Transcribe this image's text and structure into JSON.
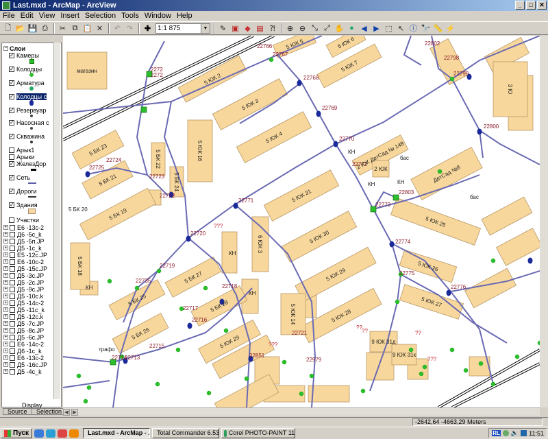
{
  "window": {
    "title": "Last.mxd - ArcMap - ArcView",
    "minimize": "_",
    "maximize": "□",
    "close": "✕"
  },
  "menu": [
    "File",
    "Edit",
    "View",
    "Insert",
    "Selection",
    "Tools",
    "Window",
    "Help"
  ],
  "toolbar": {
    "scale_value": "1:1 875"
  },
  "toc": {
    "root": "Слои",
    "layers": [
      {
        "label": "Камеры",
        "checked": true
      },
      {
        "label": "Колодцы",
        "checked": true
      },
      {
        "label": "Арматура",
        "checked": true
      },
      {
        "label": "Колодцы с",
        "checked": true,
        "selected": true
      },
      {
        "label": "Резервуар",
        "checked": true
      },
      {
        "label": "Насосная с",
        "checked": true
      },
      {
        "label": "Скважина",
        "checked": true
      },
      {
        "label": "Арык1",
        "checked": false
      },
      {
        "label": "Арыки",
        "checked": false
      },
      {
        "label": "ЖелезДор",
        "checked": true
      },
      {
        "label": "Сеть",
        "checked": true
      },
      {
        "label": "Дороги",
        "checked": true
      },
      {
        "label": "Здания",
        "checked": true
      },
      {
        "label": "Участки",
        "checked": false
      }
    ],
    "rasters": [
      "Е6 -13с-2",
      "Д6 -5с_k",
      "Д5 -5п.JP",
      "Д5 -1с_k",
      "Е5 -12с.JP",
      "Е6 -10с-2",
      "Д5 -15с.JP",
      "Д5 -3с.JP",
      "Д5 -2с.JP",
      "Д5 -9с.JP",
      "Д5 -10с.k",
      "Д5 -14с-2",
      "Д5 -11с_k",
      "Д5 -12с.k",
      "Д5 -7с.JP",
      "Д5 -8с.JP",
      "Д5 -6с.JP",
      "Е6 -14с-2",
      "Д6 -1с_k",
      "Е6 -13с-2",
      "Д5 -16с.JP",
      "Д5 -4с_k"
    ],
    "display_label": "Display",
    "tab_source": "Source",
    "tab_selection": "Selection"
  },
  "map": {
    "labels": {
      "l22766": "22766",
      "l22767": "22767",
      "l22768": "22768",
      "l22769": "22769",
      "l22770": "22770",
      "l22772": "22772",
      "l22771": "22771",
      "l22773": "22773",
      "l22774": "22774",
      "l22775": "22775",
      "l22776": "22776",
      "l22798": "22798",
      "l22799": "22799",
      "l22800": "22800",
      "l22802": "22802",
      "l22803": "22803",
      "l22724": "22724",
      "l22725": "22725",
      "l22723": "22723",
      "l22722": "22722",
      "l22720": "22720",
      "l22719": "22719",
      "l22735": "22735",
      "l22718": "22718",
      "l22717": "22717",
      "l22716": "22716",
      "l22715": "22715",
      "l22714": "22714",
      "l22713": "22713",
      "l22721": "22721",
      "l22851": "22851",
      "l22979": "22979",
      "l2272a": "2272",
      "l2272b": "2272",
      "q1": "???",
      "q2": "???",
      "q3": "???",
      "q4": "??",
      "q5": "??",
      "q6": "??"
    },
    "buildings": {
      "magazin": "магазин",
      "b5uk5": "5 ЮК  5",
      "b5uk6": "5 ЮК  6",
      "b5uk7": "5 ЮК  7",
      "b5uk2": "5 ЮК  2",
      "b5uk3": "5 ЮК  3",
      "b5uk4": "5 ЮК  4",
      "b5uk16": "5 ЮК  16",
      "b5bk23": "5 БК  23",
      "b5bk22": "5 БК  22",
      "b5bk24": "5 БК  24",
      "b5bk21": "5 БК  21",
      "b5bk20": "5 БК  20",
      "b5bk19": "5 БК  19",
      "b5bk18": "5 БК  18",
      "b5bk27": "5 БК  27",
      "b5bk25": "5 БК  25",
      "b5bk28": "5 БК  28",
      "b5bk26": "5 БК  26",
      "b5uk29a": "5 ЮК  29",
      "b5uk31": "5 ЮК  31",
      "b5uk30": "5 ЮК  30",
      "b5uk29": "5 ЮК  29",
      "b5uk28": "5 ЮК  28",
      "b5uk25": "5 ЮК  25",
      "b5uk26": "5 ЮК  26",
      "b5uk27": "5 ЮК  27",
      "b5uk32": "5 ЮК  32",
      "b5uk14": "5 ЮК  14",
      "b6uk": "6 ЮК  3",
      "b5uk": "5 ЮК",
      "ds148": "2 ЮК  ДетСад № 148",
      "ds8": "ДетСад №8",
      "b2uk": "2 ЮК",
      "b9uk31d": "9 ЮК  31д",
      "b9uk31k": "9 ЮК  31к",
      "b3": "3 Ю",
      "kn1": "КН",
      "kn2": "КН",
      "kn3": "КН",
      "kn4": "КН",
      "kn5": "КН",
      "kn6": "КН",
      "bas1": "бас",
      "bas2": "бас",
      "trafo": "трафо"
    }
  },
  "status": {
    "coords": "-2642,64  -4663,29 Meters"
  },
  "taskbar": {
    "start": "Пуск",
    "tasks": [
      "Last.mxd - ArcMap - ...",
      "Total Commander 6.53 - ...",
      "Corel PHOTO-PAINT 11"
    ],
    "lang": "RL",
    "clock": "11:51"
  }
}
